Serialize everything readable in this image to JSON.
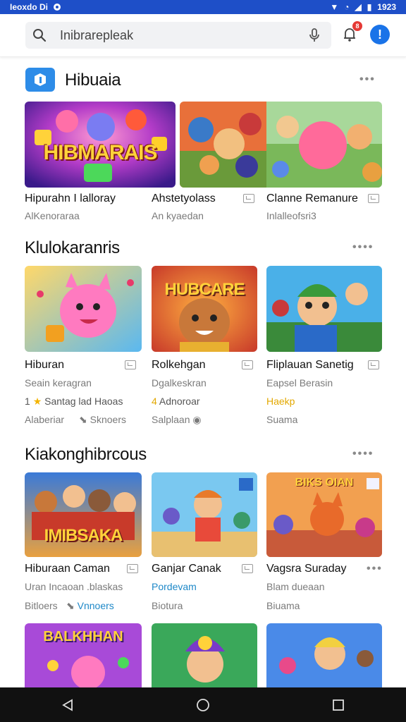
{
  "status": {
    "left_text": "Ieoxdo Di",
    "time": "1923"
  },
  "search": {
    "placeholder": "Inibrarepleak"
  },
  "notification": {
    "count": "8"
  },
  "profile": {
    "label": "!"
  },
  "sections": [
    {
      "title": "Hibuaia",
      "items": [
        {
          "art_text": "HIBMARAIS",
          "name": "Hipurahn I lalloray",
          "sub": "AlKenoraraa"
        },
        {
          "name": "Ahstetyolass",
          "sub": "An kyaedan"
        },
        {
          "name": "Clanne Remanure",
          "sub": "Inlalleofsri3"
        }
      ]
    },
    {
      "title": "Klulokaranris",
      "items": [
        {
          "name": "Hiburan",
          "sub": "Seain keragran",
          "rating": "1",
          "meta1": "Santag lad Haoas",
          "meta2": "Alaberiar",
          "meta3": "Sknoers"
        },
        {
          "art_text": "HUBCARE",
          "name": "Rolkehgan",
          "sub": "Dgalkeskran",
          "rating": "4",
          "meta1": "Adnoroar",
          "meta2": "Salplaan"
        },
        {
          "name": "Fliplauan Sanetig",
          "sub": "Eapsel Berasin",
          "meta1": "Haekp",
          "meta2": "Suama"
        }
      ]
    },
    {
      "title": "Kiakonghibrcous",
      "items": [
        {
          "art_text": "IMIBSAKA",
          "name": "Hiburaan Caman",
          "sub": "Uran Incaoan .blaskas",
          "meta1": "Bitloers",
          "meta2": "Vnnoers"
        },
        {
          "name": "Ganjar Canak",
          "sub": "Pordevam",
          "meta1": "Biotura"
        },
        {
          "art_text": "BIKS OIAN",
          "name": "Vagsra Suraday",
          "sub": "Blam dueaan",
          "meta1": "Biuama"
        }
      ]
    },
    {
      "items": [
        {
          "art_text": "BALKHHAN"
        },
        {},
        {}
      ]
    }
  ],
  "colors": {
    "status_bar": "#1e4fc8",
    "accent": "#1a73e8",
    "badge": "#e53935"
  },
  "icons": [
    "search-icon",
    "mic-icon",
    "bell-icon",
    "more-icon",
    "save-icon",
    "back-icon",
    "home-icon",
    "recents-icon"
  ]
}
